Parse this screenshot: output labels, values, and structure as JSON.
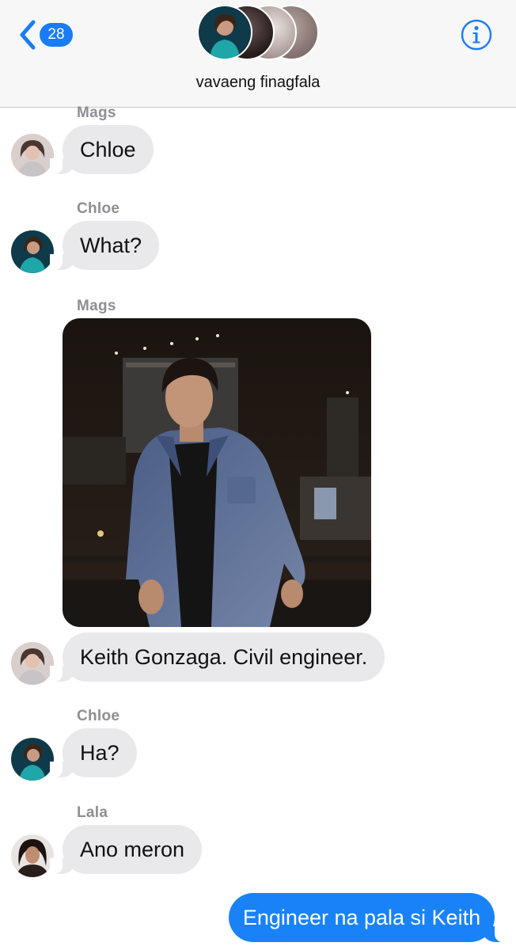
{
  "header": {
    "back_count": "28",
    "group_name": "vavaeng finagfala"
  },
  "messages": [
    {
      "sender": "Mags",
      "text": "Chloe"
    },
    {
      "sender": "Chloe",
      "text": "What?"
    },
    {
      "sender": "Mags",
      "text": "Keith Gonzaga. Civil engineer."
    },
    {
      "sender": "Chloe",
      "text": "Ha?"
    },
    {
      "sender": "Lala",
      "text": "Ano meron"
    }
  ],
  "outgoing": {
    "text": "Engineer na pala si Keith"
  },
  "colors": {
    "accent": "#1a82f7",
    "incoming_bubble": "#e9e9eb",
    "sender_label": "#8e8e93"
  },
  "icons": {
    "back": "chevron-left-icon",
    "info": "info-icon"
  }
}
